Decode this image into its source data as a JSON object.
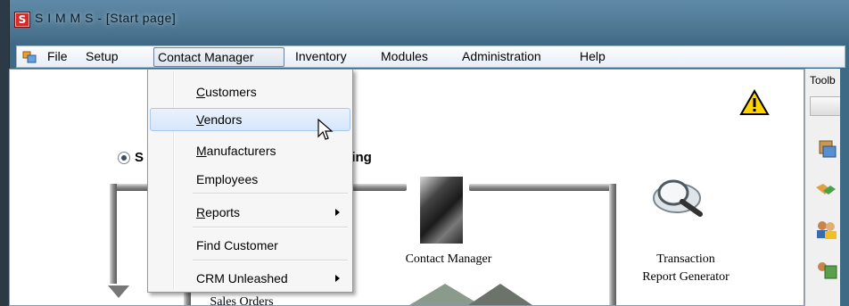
{
  "window": {
    "title": "S I M M S  - [Start page]",
    "app_icon_letter": "S"
  },
  "menubar": {
    "items": [
      {
        "label": "File"
      },
      {
        "label": "Setup"
      },
      {
        "label": "Contact Manager"
      },
      {
        "label": "Inventory"
      },
      {
        "label": "Modules"
      },
      {
        "label": "Administration"
      },
      {
        "label": "Help"
      }
    ]
  },
  "dropdown": {
    "items": [
      {
        "label": "Customers",
        "accel": "C",
        "rest": "ustomers"
      },
      {
        "label": "Vendors",
        "accel": "V",
        "rest": "endors"
      },
      {
        "label": "Manufacturers",
        "accel": "M",
        "rest": "anufacturers"
      },
      {
        "label": "Employees"
      },
      {
        "label": "Reports",
        "accel": "R",
        "rest": "eports"
      },
      {
        "label": "Find Customer"
      },
      {
        "label": "CRM Unleashed"
      }
    ],
    "highlighted": "Vendors"
  },
  "start_page": {
    "radio_label_left": "S",
    "radio_label_right": "sing",
    "contact_manager_caption": "Contact Manager",
    "transaction_caption_line1": "Transaction",
    "transaction_caption_line2": "Report Generator",
    "sales_orders_caption": "Sales Orders"
  },
  "toolbox": {
    "title": "Toolb"
  },
  "colors": {
    "title_gradient_top": "#5f8aa8",
    "menu_hover": "#d6e6fb",
    "app_icon_red": "#d42b2b"
  }
}
